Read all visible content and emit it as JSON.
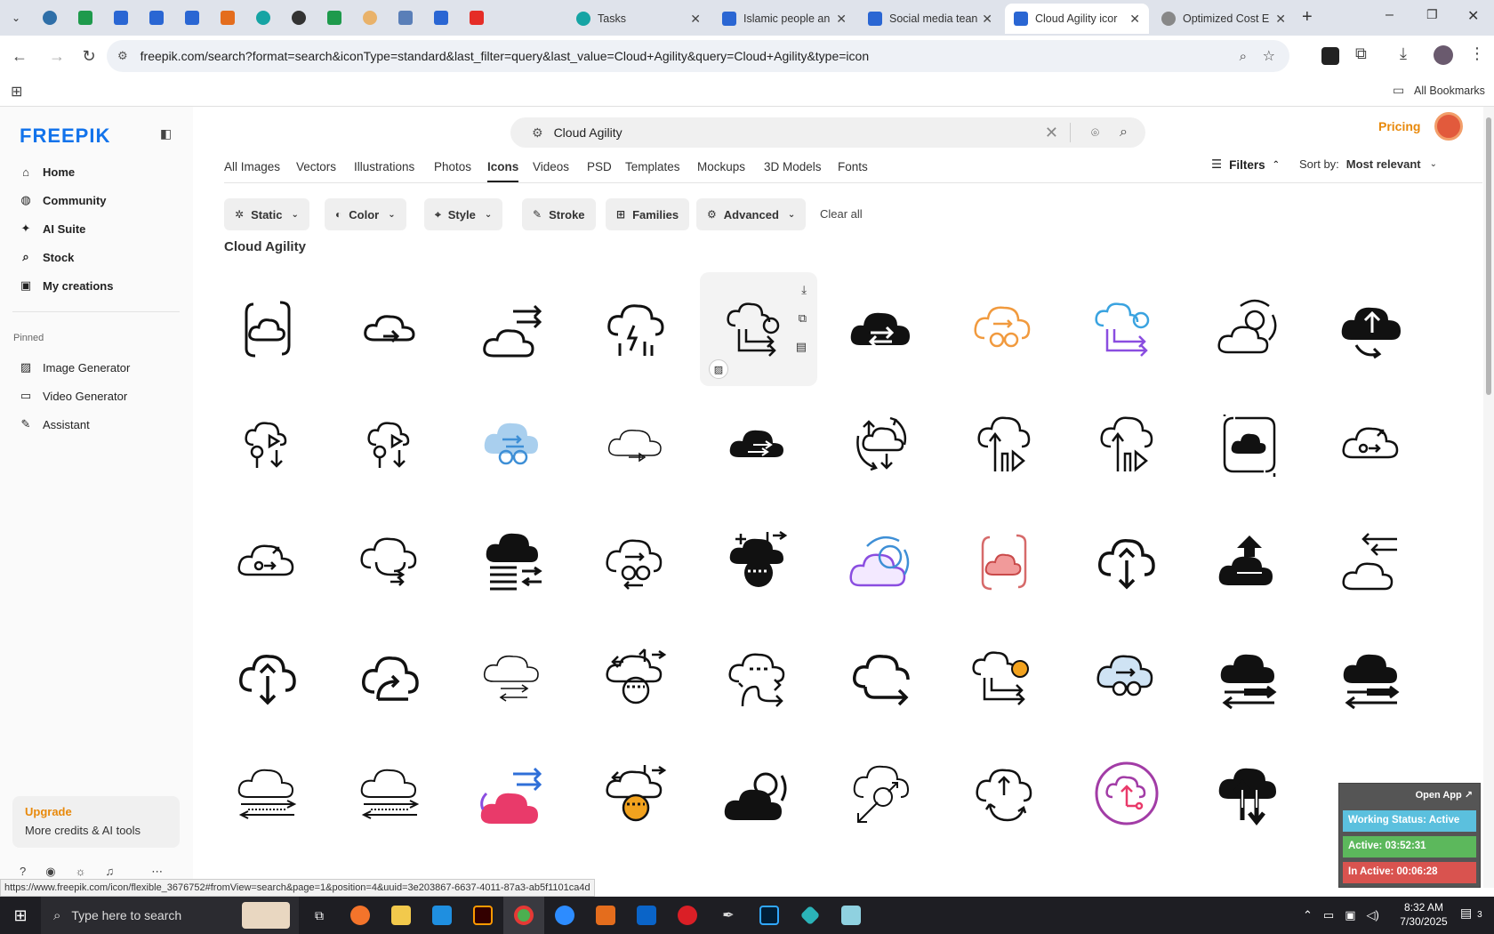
{
  "browser": {
    "tabs": [
      {
        "title": "Tasks",
        "color": "#16a4a4"
      },
      {
        "title": "Islamic people an",
        "color": "#2a66d3"
      },
      {
        "title": "Social media tean",
        "color": "#2a66d3"
      },
      {
        "title": "Cloud Agility icor",
        "color": "#2a66d3"
      },
      {
        "title": "Optimized Cost E",
        "color": "#888888"
      }
    ],
    "url": "freepik.com/search?format=search&iconType=standard&last_filter=query&last_value=Cloud+Agility&query=Cloud+Agility&type=icon",
    "bookmarks_label": "All Bookmarks"
  },
  "sidebar": {
    "logo": "FREEPIK",
    "nav": [
      {
        "label": "Home",
        "icon": "home-icon"
      },
      {
        "label": "Community",
        "icon": "globe-icon"
      },
      {
        "label": "AI Suite",
        "icon": "sparkle-icon"
      },
      {
        "label": "Stock",
        "icon": "search-icon"
      },
      {
        "label": "My creations",
        "icon": "folder-icon"
      }
    ],
    "pinned_title": "Pinned",
    "pinned": [
      {
        "label": "Image Generator",
        "icon": "image-icon"
      },
      {
        "label": "Video Generator",
        "icon": "video-icon"
      },
      {
        "label": "Assistant",
        "icon": "chat-icon"
      }
    ],
    "upgrade": {
      "title": "Upgrade",
      "subtitle": "More credits & AI tools"
    }
  },
  "header": {
    "search_value": "Cloud Agility",
    "pricing": "Pricing"
  },
  "categories": [
    "All Images",
    "Vectors",
    "Illustrations",
    "Photos",
    "Icons",
    "Videos",
    "PSD",
    "Templates",
    "Mockups",
    "3D Models",
    "Fonts"
  ],
  "active_category": "Icons",
  "filters_label": "Filters",
  "sort": {
    "label": "Sort by:",
    "value": "Most relevant"
  },
  "chips": [
    {
      "label": "Static",
      "icon": "sparkle-icon",
      "chevron": true
    },
    {
      "label": "Color",
      "icon": "palette-icon",
      "chevron": true
    },
    {
      "label": "Style",
      "icon": "brush-icon",
      "chevron": true
    },
    {
      "label": "Stroke",
      "icon": "pen-icon",
      "chevron": false
    },
    {
      "label": "Families",
      "icon": "grid-icon",
      "chevron": false
    },
    {
      "label": "Advanced",
      "icon": "gear-icon",
      "chevron": true
    }
  ],
  "clear_all": "Clear all",
  "results_title": "Cloud Agility",
  "status_url": "https://www.freepik.com/icon/flexible_3676752#fromView=search&page=1&position=4&uuid=3e203867-6637-4011-87a3-ab5f1101ca4d",
  "taskbar": {
    "search_placeholder": "Type here to search",
    "time": "8:32 AM",
    "date": "7/30/2025",
    "notifications": "3"
  },
  "widget": {
    "open_app": "Open App ↗",
    "status": "Working Status: Active",
    "active": "Active: 03:52:31",
    "inactive": "In Active: 00:06:28"
  },
  "colors": {
    "brand_blue": "#1273eb",
    "pricing_orange": "#e8890b",
    "upgrade_orange": "#e8890b",
    "widget_blue": "#5bc0de",
    "widget_green": "#5cb85c",
    "widget_red": "#d9534f"
  }
}
